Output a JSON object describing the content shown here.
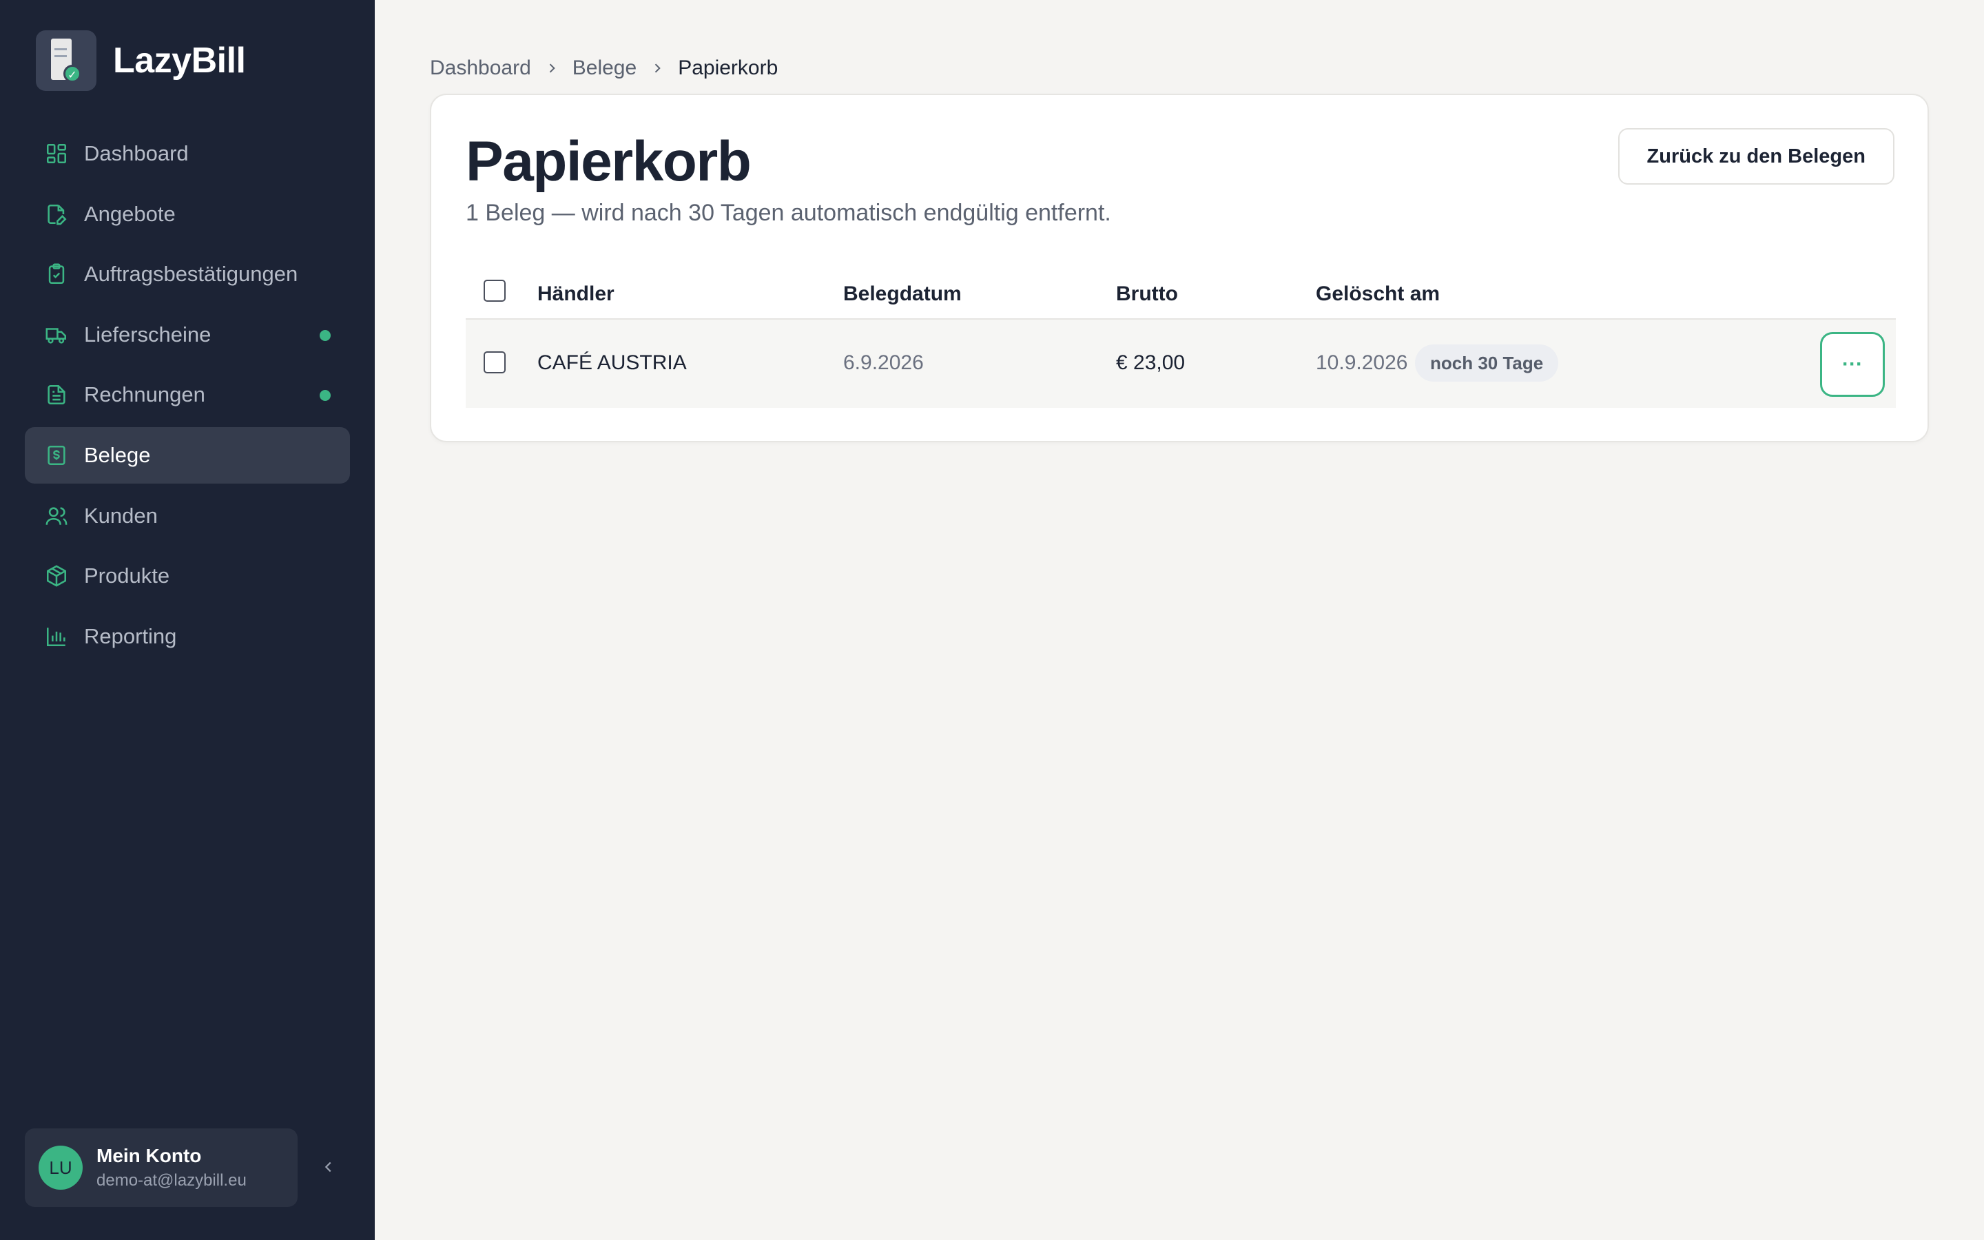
{
  "brand": {
    "name": "LazyBill"
  },
  "sidebar": {
    "items": [
      {
        "label": "Dashboard",
        "icon": "dashboard-icon",
        "active": false,
        "dot": false
      },
      {
        "label": "Angebote",
        "icon": "document-pen-icon",
        "active": false,
        "dot": false
      },
      {
        "label": "Auftragsbestätigungen",
        "icon": "clipboard-check-icon",
        "active": false,
        "dot": false
      },
      {
        "label": "Lieferscheine",
        "icon": "truck-icon",
        "active": false,
        "dot": true
      },
      {
        "label": "Rechnungen",
        "icon": "invoice-icon",
        "active": false,
        "dot": true
      },
      {
        "label": "Belege",
        "icon": "receipt-dollar-icon",
        "active": true,
        "dot": false
      },
      {
        "label": "Kunden",
        "icon": "users-icon",
        "active": false,
        "dot": false
      },
      {
        "label": "Produkte",
        "icon": "box-icon",
        "active": false,
        "dot": false
      },
      {
        "label": "Reporting",
        "icon": "bar-chart-icon",
        "active": false,
        "dot": false
      }
    ]
  },
  "account": {
    "initials": "LU",
    "name": "Mein Konto",
    "email": "demo-at@lazybill.eu"
  },
  "breadcrumb": {
    "items": [
      "Dashboard",
      "Belege",
      "Papierkorb"
    ]
  },
  "page": {
    "title": "Papierkorb",
    "subtitle": "1 Beleg — wird nach 30 Tagen automatisch endgültig entfernt.",
    "back_button": "Zurück zu den Belegen"
  },
  "table": {
    "headers": {
      "merchant": "Händler",
      "date": "Belegdatum",
      "gross": "Brutto",
      "deleted": "Gelöscht am"
    },
    "rows": [
      {
        "merchant": "CAFÉ AUSTRIA",
        "date": "6.9.2026",
        "gross": "€ 23,00",
        "deleted": "10.9.2026",
        "remaining": "noch 30 Tage",
        "more": "···"
      }
    ]
  },
  "colors": {
    "sidebar_bg": "#1c2335",
    "accent": "#3bb584",
    "page_bg": "#f5f4f2"
  }
}
